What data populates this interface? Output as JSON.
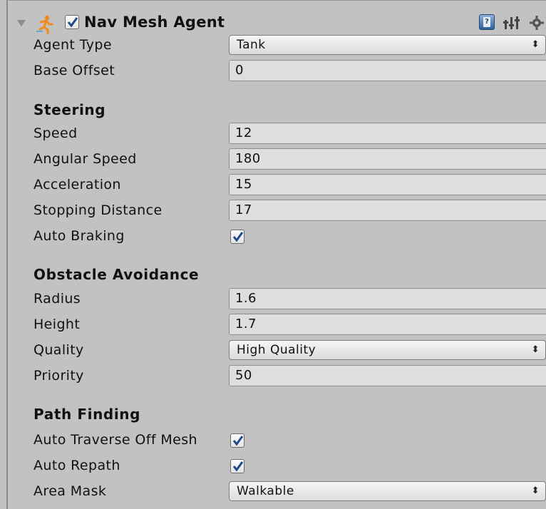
{
  "component": {
    "title": "Nav Mesh Agent",
    "enabled": true,
    "icons": [
      "foldout-arrow-icon",
      "nav-mesh-agent-icon",
      "help-book-icon",
      "preset-icon",
      "gear-icon"
    ]
  },
  "fields": {
    "agent_type": {
      "label": "Agent Type",
      "value": "Tank"
    },
    "base_offset": {
      "label": "Base Offset",
      "value": "0"
    }
  },
  "steering": {
    "title": "Steering",
    "speed": {
      "label": "Speed",
      "value": "12"
    },
    "angular_speed": {
      "label": "Angular Speed",
      "value": "180"
    },
    "acceleration": {
      "label": "Acceleration",
      "value": "15"
    },
    "stopping_distance": {
      "label": "Stopping Distance",
      "value": "17"
    },
    "auto_braking": {
      "label": "Auto Braking",
      "checked": true
    }
  },
  "obstacle_avoidance": {
    "title": "Obstacle Avoidance",
    "radius": {
      "label": "Radius",
      "value": "1.6"
    },
    "height": {
      "label": "Height",
      "value": "1.7"
    },
    "quality": {
      "label": "Quality",
      "value": "High Quality"
    },
    "priority": {
      "label": "Priority",
      "value": "50"
    }
  },
  "path_finding": {
    "title": "Path Finding",
    "auto_traverse": {
      "label": "Auto Traverse Off Mesh",
      "checked": true
    },
    "auto_repath": {
      "label": "Auto Repath",
      "checked": true
    },
    "area_mask": {
      "label": "Area Mask",
      "value": "Walkable"
    }
  },
  "dropdown_arrow_glyph": "⬍",
  "colors": {
    "panel_bg": "#c2c2c2",
    "field_bg": "#dedede",
    "checkmark": "#1f4a8a",
    "help_blue": "#2f5f99",
    "agent_orange": "#f08a1c"
  }
}
